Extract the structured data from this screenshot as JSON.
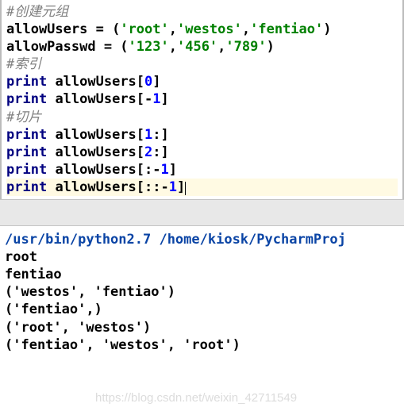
{
  "code": {
    "c1": "#创建元组",
    "l2_id": "allowUsers",
    "l2_a": " = (",
    "l2_s1": "'root'",
    "l2_c": ",",
    "l2_s2": "'westos'",
    "l2_s3": "'fentiao'",
    "l2_z": ")",
    "l3_id": "allowPasswd",
    "l3_a": " = (",
    "l3_s1": "'123'",
    "l3_s2": "'456'",
    "l3_s3": "'789'",
    "l3_z": ")",
    "c2": "#索引",
    "kw_print": "print",
    "sp": " ",
    "au": "allowUsers",
    "lb": "[",
    "rb": "]",
    "n0": "0",
    "nm1": "-",
    "n1": "1",
    "n2": "2",
    "colon": ":",
    "c3": "#切片"
  },
  "console": {
    "cmd": "/usr/bin/python2.7 /home/kiosk/PycharmProj",
    "o1": "root",
    "o2": "fentiao",
    "o3": "('westos', 'fentiao')",
    "o4": "('fentiao',)",
    "o5": "('root', 'westos')",
    "o6": "('fentiao', 'westos', 'root')"
  },
  "watermark": "https://blog.csdn.net/weixin_42711549",
  "chart_data": {
    "type": "table",
    "title": "Python tuple indexing and slicing example",
    "code_lines": [
      "#创建元组",
      "allowUsers = ('root','westos','fentiao')",
      "allowPasswd = ('123','456','789')",
      "#索引",
      "print allowUsers[0]",
      "print allowUsers[-1]",
      "#切片",
      "print allowUsers[1:]",
      "print allowUsers[2:]",
      "print allowUsers[:-1]",
      "print allowUsers[::-1]"
    ],
    "output_lines": [
      "/usr/bin/python2.7 /home/kiosk/PycharmProj",
      "root",
      "fentiao",
      "('westos', 'fentiao')",
      "('fentiao',)",
      "('root', 'westos')",
      "('fentiao', 'westos', 'root')"
    ]
  }
}
